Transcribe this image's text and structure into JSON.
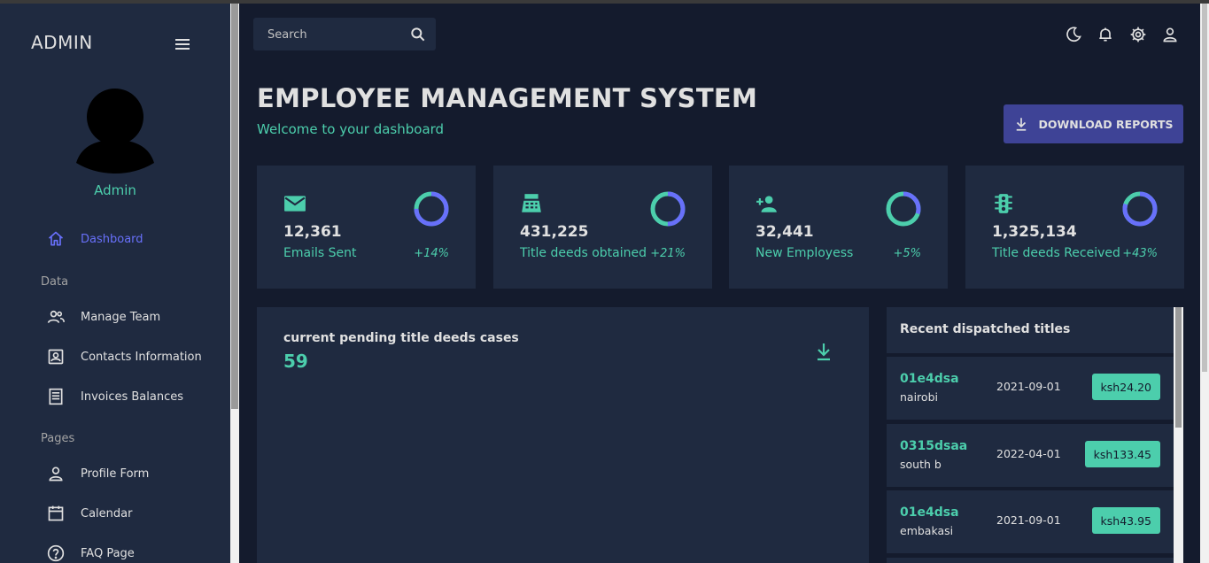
{
  "sidebar": {
    "brand": "ADMIN",
    "user_name": "Admin",
    "sections": {
      "data": "Data",
      "pages": "Pages"
    },
    "items": [
      {
        "label": "Dashboard",
        "icon": "home-icon"
      },
      {
        "label": "Manage Team",
        "icon": "people-icon"
      },
      {
        "label": "Contacts Information",
        "icon": "contacts-icon"
      },
      {
        "label": "Invoices Balances",
        "icon": "receipt-icon"
      },
      {
        "label": "Profile Form",
        "icon": "person-icon"
      },
      {
        "label": "Calendar",
        "icon": "calendar-icon"
      },
      {
        "label": "FAQ Page",
        "icon": "help-icon"
      }
    ]
  },
  "search": {
    "placeholder": "Search"
  },
  "header": {
    "title": "EMPLOYEE MANAGEMENT SYSTEM",
    "subtitle": "Welcome to your dashboard",
    "download_label": "DOWNLOAD REPORTS"
  },
  "stats": [
    {
      "value": "12,361",
      "label": "Emails Sent",
      "increase": "+14%",
      "icon": "email-icon",
      "progress": 0.75
    },
    {
      "value": "431,225",
      "label": "Title deeds obtained",
      "increase": "+21%",
      "icon": "point-of-sale-icon",
      "progress": 0.5
    },
    {
      "value": "32,441",
      "label": "New Employess",
      "increase": "+5%",
      "icon": "person-add-icon",
      "progress": 0.3
    },
    {
      "value": "1,325,134",
      "label": "Title deeds Received",
      "increase": "+43%",
      "icon": "traffic-icon",
      "progress": 0.8
    }
  ],
  "chart_card": {
    "title": "current pending title deeds cases",
    "value": "59"
  },
  "recent": {
    "title": "Recent dispatched titles",
    "rows": [
      {
        "id": "01e4dsa",
        "location": "nairobi",
        "date": "2021-09-01",
        "amount": "ksh24.20"
      },
      {
        "id": "0315dsaa",
        "location": "south b",
        "date": "2022-04-01",
        "amount": "ksh133.45"
      },
      {
        "id": "01e4dsa",
        "location": "embakasi",
        "date": "2021-09-01",
        "amount": "ksh43.95"
      }
    ]
  },
  "colors": {
    "accent_green": "#4cceac",
    "accent_blue": "#6870fa",
    "button_bg": "#3e4396",
    "card_bg": "#1f2a40",
    "page_bg": "#141b2d"
  }
}
